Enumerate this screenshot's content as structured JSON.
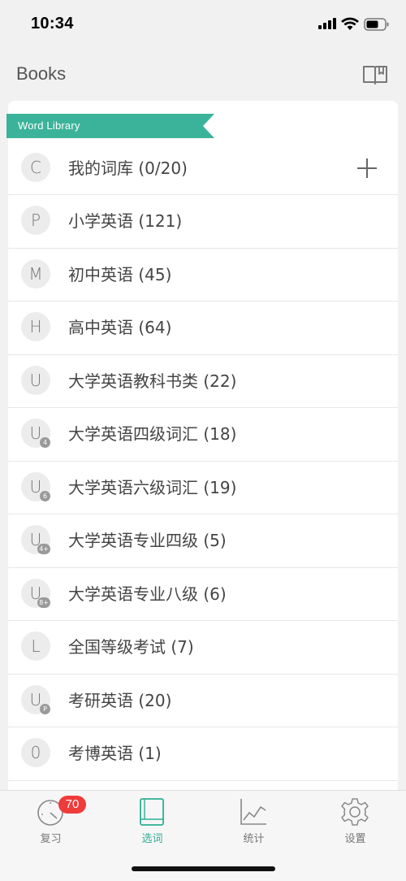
{
  "status_bar": {
    "time": "10:34"
  },
  "header": {
    "title": "Books",
    "book_icon": "open-book-icon"
  },
  "library": {
    "ribbon_label": "Word Library",
    "accent": "#3bb39a",
    "items": [
      {
        "letter": "C",
        "sub": "",
        "label": "我的词库 (0/20)"
      },
      {
        "letter": "P",
        "sub": "",
        "label": "小学英语 (121)"
      },
      {
        "letter": "M",
        "sub": "",
        "label": "初中英语 (45)"
      },
      {
        "letter": "H",
        "sub": "",
        "label": "高中英语 (64)"
      },
      {
        "letter": "U",
        "sub": "",
        "label": "大学英语教科书类 (22)"
      },
      {
        "letter": "U",
        "sub": "4",
        "label": "大学英语四级词汇 (18)"
      },
      {
        "letter": "U",
        "sub": "6",
        "label": "大学英语六级词汇 (19)"
      },
      {
        "letter": "U",
        "sub": "4+",
        "label": "大学英语专业四级 (5)"
      },
      {
        "letter": "U",
        "sub": "8+",
        "label": "大学英语专业八级 (6)"
      },
      {
        "letter": "L",
        "sub": "",
        "label": "全国等级考试 (7)"
      },
      {
        "letter": "U",
        "sub": "P",
        "label": "考研英语 (20)"
      },
      {
        "letter": "0",
        "sub": "",
        "label": "考博英语 (1)"
      }
    ]
  },
  "tabbar": {
    "badge_color": "#f03b3b",
    "tabs": [
      {
        "label": "复习",
        "icon": "gauge-icon",
        "badge": "70"
      },
      {
        "label": "选词",
        "icon": "book-icon",
        "active": true
      },
      {
        "label": "统计",
        "icon": "line-chart-icon"
      },
      {
        "label": "设置",
        "icon": "gear-icon"
      }
    ]
  }
}
